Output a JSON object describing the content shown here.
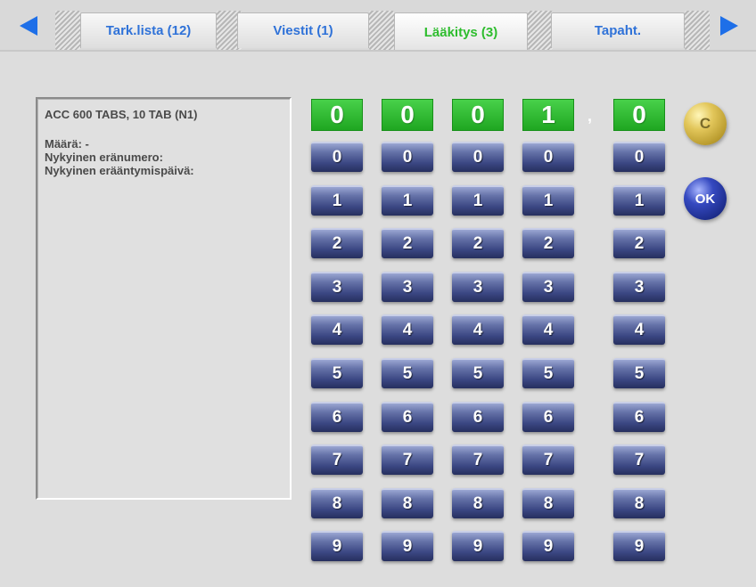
{
  "tabs": [
    {
      "label": "Tark.lista (12)",
      "active": false
    },
    {
      "label": "Viestit (1)",
      "active": false
    },
    {
      "label": "Lääkitys (3)",
      "active": true
    },
    {
      "label": "Tapaht.",
      "active": false
    }
  ],
  "info": {
    "title": "ACC 600 TABS, 10 TAB (N1)",
    "amount": "Määrä: -",
    "batch": "Nykyinen eränumero:",
    "expiry": "Nykyinen erääntymispäivä:"
  },
  "displays": [
    "0",
    "0",
    "0",
    "1",
    "0"
  ],
  "separator": ",",
  "digits": [
    "0",
    "1",
    "2",
    "3",
    "4",
    "5",
    "6",
    "7",
    "8",
    "9"
  ],
  "buttons": {
    "clear": "C",
    "ok": "OK"
  },
  "colors": {
    "accent": "#2f72d8",
    "active_tab": "#2ebd2e",
    "display": "#2bb82d",
    "key": "#3a4682"
  }
}
